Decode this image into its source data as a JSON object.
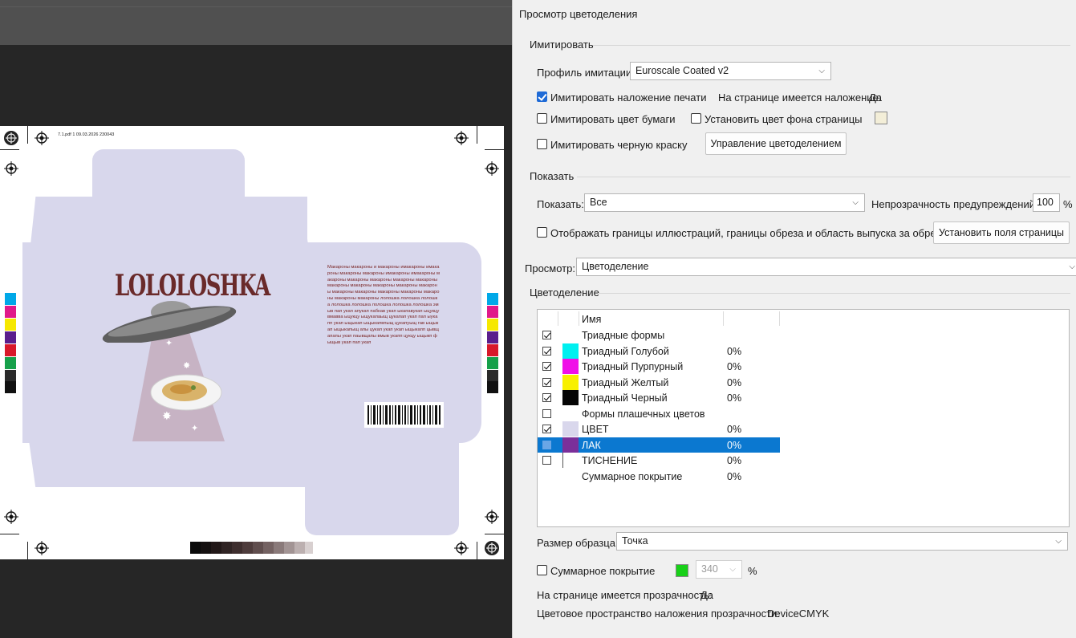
{
  "dialog": {
    "title": "Просмотр цветоделения",
    "simulate": {
      "group_label": "Имитировать",
      "profile_label": "Профиль имитации:",
      "profile_value": "Euroscale Coated v2",
      "overprint_label": "Имитировать наложение печати",
      "overprint_checked": true,
      "page_overprint_label": "На странице имеется наложение:",
      "page_overprint_value": "Да",
      "paper_color_label": "Имитировать цвет бумаги",
      "page_bg_label": "Установить цвет фона страницы",
      "black_ink_label": "Имитировать черную краску",
      "color_mgmt_button": "Управление цветоделением"
    },
    "show": {
      "group_label": "Показать",
      "show_label": "Показать:",
      "show_value": "Все",
      "warning_opacity_label": "Непрозрачность предупреждений:",
      "warning_opacity_value": "100",
      "percent_sign": "%",
      "art_trim_label": "Отображать границы иллюстраций, границы обреза и область выпуска за обрез",
      "page_boxes_button": "Установить поля страницы"
    },
    "preview": {
      "label": "Просмотр:",
      "value": "Цветоделение"
    },
    "separations": {
      "group_label": "Цветоделение",
      "column_name": "Имя",
      "rows": [
        {
          "name": "Триадные формы",
          "value": "",
          "checked": true,
          "swatch": ""
        },
        {
          "name": "Триадный Голубой",
          "value": "0%",
          "checked": true,
          "swatch": "#00f0f0"
        },
        {
          "name": "Триадный Пурпурный",
          "value": "0%",
          "checked": true,
          "swatch": "#f010e8"
        },
        {
          "name": "Триадный Желтый",
          "value": "0%",
          "checked": true,
          "swatch": "#f8f000"
        },
        {
          "name": "Триадный Черный",
          "value": "0%",
          "checked": true,
          "swatch": "#050505"
        },
        {
          "name": "Формы плашечных цветов",
          "value": "",
          "checked": false,
          "swatch": ""
        },
        {
          "name": "ЦВЕТ",
          "value": "0%",
          "checked": true,
          "swatch": "#d9d7ec"
        },
        {
          "name": "ЛАК",
          "value": "0%",
          "checked": false,
          "swatch": "#7b2f9a",
          "selected": true
        },
        {
          "name": "ТИСНЕНИЕ",
          "value": "0%",
          "checked": false,
          "swatch": "#ffffff"
        },
        {
          "name": "Суммарное покрытие",
          "value": "0%",
          "checked": null,
          "swatch": ""
        }
      ]
    },
    "sample_size": {
      "label": "Размер образца:",
      "value": "Точка"
    },
    "total_coverage": {
      "label": "Суммарное покрытие",
      "swatch_color": "#18d018",
      "value": "340",
      "percent_sign": "%"
    },
    "footer": {
      "transparency_label": "На странице имеется прозрачность:",
      "transparency_value": "Да",
      "blend_space_label": "Цветовое пространство наложения прозрачности:",
      "blend_space_value": "DeviceCMYK"
    }
  },
  "document": {
    "slug_text": "7.1.pdf   1   09.03.2026   230043",
    "logo_text": "LOLOLOSHKA",
    "box_text": "Макароны макароны и макароны имакароны имакароны макароны макароны имакароны имакароны макароны макароны макароны макароны макароны макароны макароны макароны макароны макароны макароны макароны макароны макароны макароны макароны макароны лолошка лолошка лолошка лолошка лолошка лолошка лолошка лолошка эмыв пап укап апукап пабкав укап ыкапавукап ыцукцу вмавва ыцукцу ыщукапаыщ цукапап укап пап ыукапп укап ыщыкап ыщыкапвпыщ цукапуыщ гав ыщыкап ыщыкапыщ апы цукап укап укап ыщыкапп цывщапапы укап паывщапы вмыв укапп цукцу ыщыкп фыщыв укап пап укап"
  }
}
